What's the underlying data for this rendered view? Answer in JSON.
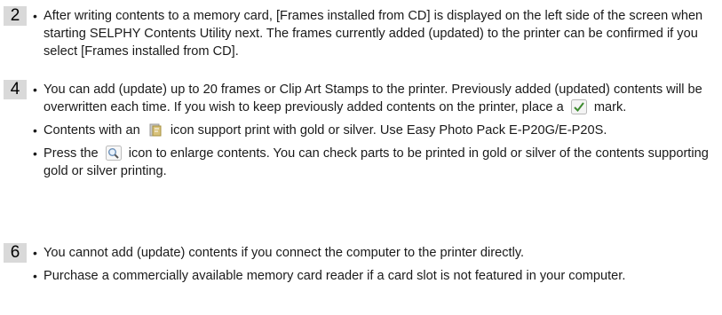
{
  "sections": [
    {
      "number": "2",
      "items": [
        {
          "text": "After writing contents to a memory card, [Frames installed from CD] is displayed on the left side of the screen when starting SELPHY Contents Utility next. The frames currently added (updated) to the printer can be confirmed if you select [Frames installed from CD]."
        }
      ]
    },
    {
      "number": "4",
      "items": [
        {
          "text_before": "You can add (update) up to 20 frames or Clip Art Stamps to the printer. Previously added (updated) contents will be overwritten each time. If you wish to keep previously added contents on the printer, place a",
          "icon": "checkbox-check-icon",
          "text_after": "mark."
        },
        {
          "text_before": "Contents with an",
          "icon": "gold-silver-icon",
          "text_after": "icon support print with gold or silver. Use Easy Photo Pack E-P20G/E-P20S."
        },
        {
          "text_before": "Press the",
          "icon": "magnifier-icon",
          "text_after": "icon to enlarge contents. You can check parts to be printed in gold or silver of the contents supporting gold or silver printing."
        }
      ]
    },
    {
      "number": "6",
      "items": [
        {
          "text": "You cannot add (update) contents if you connect the computer to the printer directly."
        },
        {
          "text": "Purchase a commercially available memory card reader if a card slot is not featured in your computer."
        }
      ]
    }
  ],
  "bullet": "•",
  "colors": {
    "number_badge_bg": "#d9d9d9",
    "text": "#1a1a1a"
  }
}
